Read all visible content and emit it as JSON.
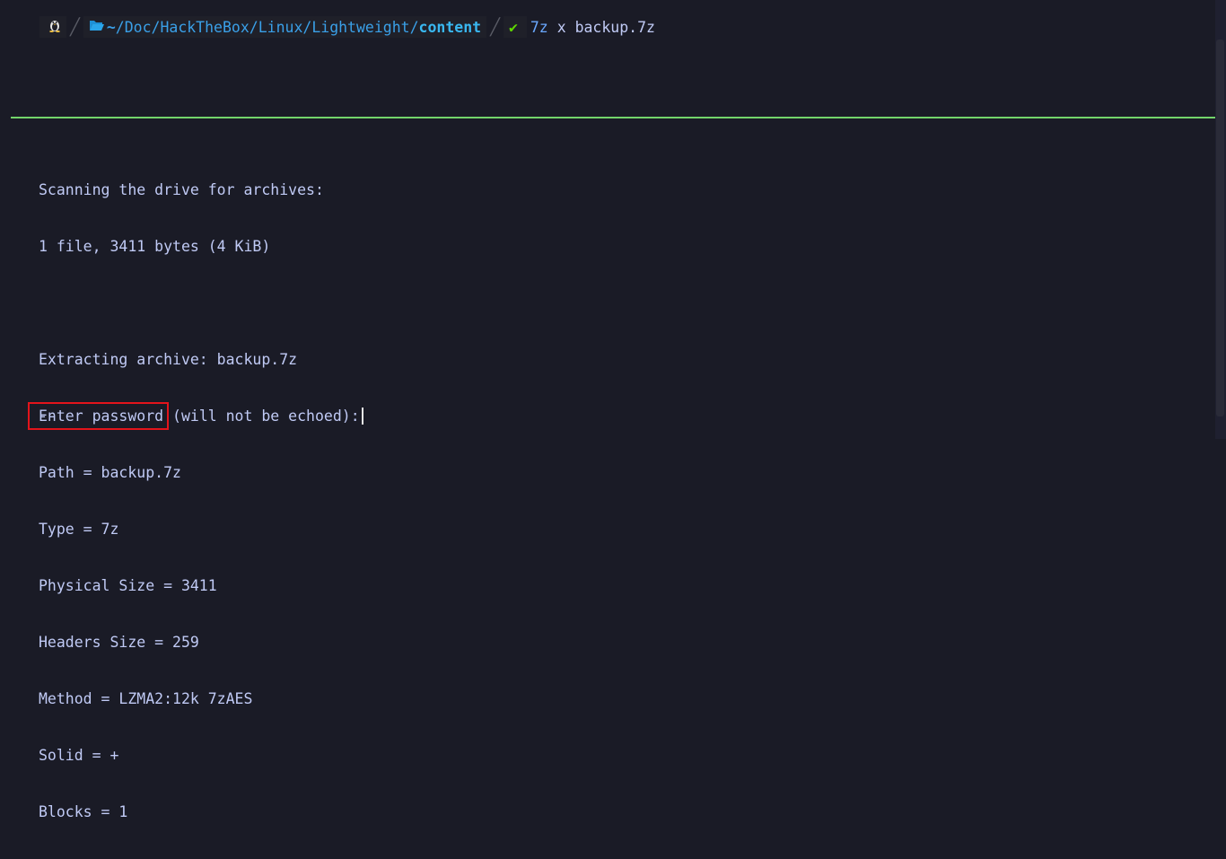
{
  "prompt": {
    "os_icon": "linux-tux-icon",
    "folder_icon": "folder-open-icon",
    "path_home": "~",
    "path_middle": "/Doc/HackTheBox/Linux/Lightweight/",
    "path_last": "content",
    "status_icon": "check-icon",
    "status_glyph": "✔",
    "command_name": "7z",
    "command_sub": "x",
    "command_arg": "backup.7z"
  },
  "output_lines": [
    "Scanning the drive for archives:",
    "1 file, 3411 bytes (4 KiB)",
    "",
    "Extracting archive: backup.7z",
    "--",
    "Path = backup.7z",
    "Type = 7z",
    "Physical Size = 3411",
    "Headers Size = 259",
    "Method = LZMA2:12k 7zAES",
    "Solid = +",
    "Blocks = 1"
  ],
  "password_prompt": {
    "label": "Enter password",
    "rest": " (will not be echoed):"
  },
  "colors": {
    "background": "#1a1b26",
    "rule": "#73d56a",
    "highlight_box": "#e3141b",
    "path": "#3aa0e8",
    "ok": "#5fd700"
  }
}
